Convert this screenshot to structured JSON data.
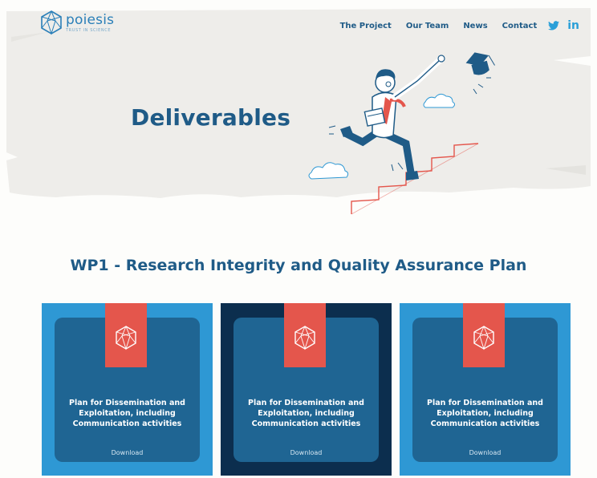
{
  "brand": {
    "name": "poiesis",
    "tagline": "TRUST IN SCIENCE"
  },
  "nav": {
    "items": [
      {
        "label": "The Project"
      },
      {
        "label": "Our Team"
      },
      {
        "label": "News"
      },
      {
        "label": "Contact"
      }
    ],
    "social": {
      "twitter_icon": "twitter-icon",
      "linkedin_label": "in"
    }
  },
  "hero": {
    "title": "Deliverables",
    "illustration": "scientist-running-up-stairs"
  },
  "section": {
    "title": "WP1 - Research Integrity and Quality Assurance Plan"
  },
  "cards": [
    {
      "title": "Plan for Dissemination and Exploitation, including Communication activities",
      "download_label": "Download"
    },
    {
      "title": "Plan for Dissemination and Exploitation, including Communication activities",
      "download_label": "Download"
    },
    {
      "title": "Plan for Dissemination and Exploitation, including Communication activities",
      "download_label": "Download"
    }
  ],
  "colors": {
    "primary": "#1f5b87",
    "accent_blue": "#2e98d4",
    "navy": "#0c2e4e",
    "card_inner": "#1f6593",
    "tag_red": "#e4564c",
    "stairs_red": "#e4564c"
  }
}
